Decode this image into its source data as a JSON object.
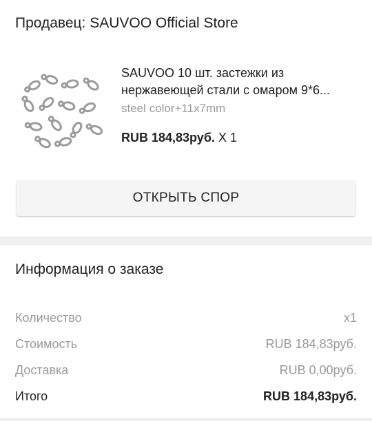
{
  "seller": {
    "text": "Продавец: SAUVOO Official Store"
  },
  "product": {
    "title_line1": "SAUVOO 10 шт. застежки из",
    "title_line2": "нержавеющей стали с омаром 9*6...",
    "variant": "steel color+11x7mm",
    "price": "RUB 184,83руб.",
    "quantity": "X 1",
    "image_icon": "lobster-clasp-photo"
  },
  "actions": {
    "dispute_label": "ОТКРЫТЬ СПОР"
  },
  "order_info": {
    "title": "Информация о заказе",
    "rows": [
      {
        "label": "Количество",
        "value": "x1"
      },
      {
        "label": "Стоимость",
        "value": "RUB 184,83руб."
      },
      {
        "label": "Доставка",
        "value": "RUB 0,00руб."
      }
    ],
    "total": {
      "label": "Итого",
      "value": "RUB 184,83руб."
    }
  },
  "colors": {
    "text_primary": "#222222",
    "text_secondary": "#9a9a9a",
    "button_bg": "#f5f5f5",
    "divider_bg": "#f0f0f0"
  }
}
